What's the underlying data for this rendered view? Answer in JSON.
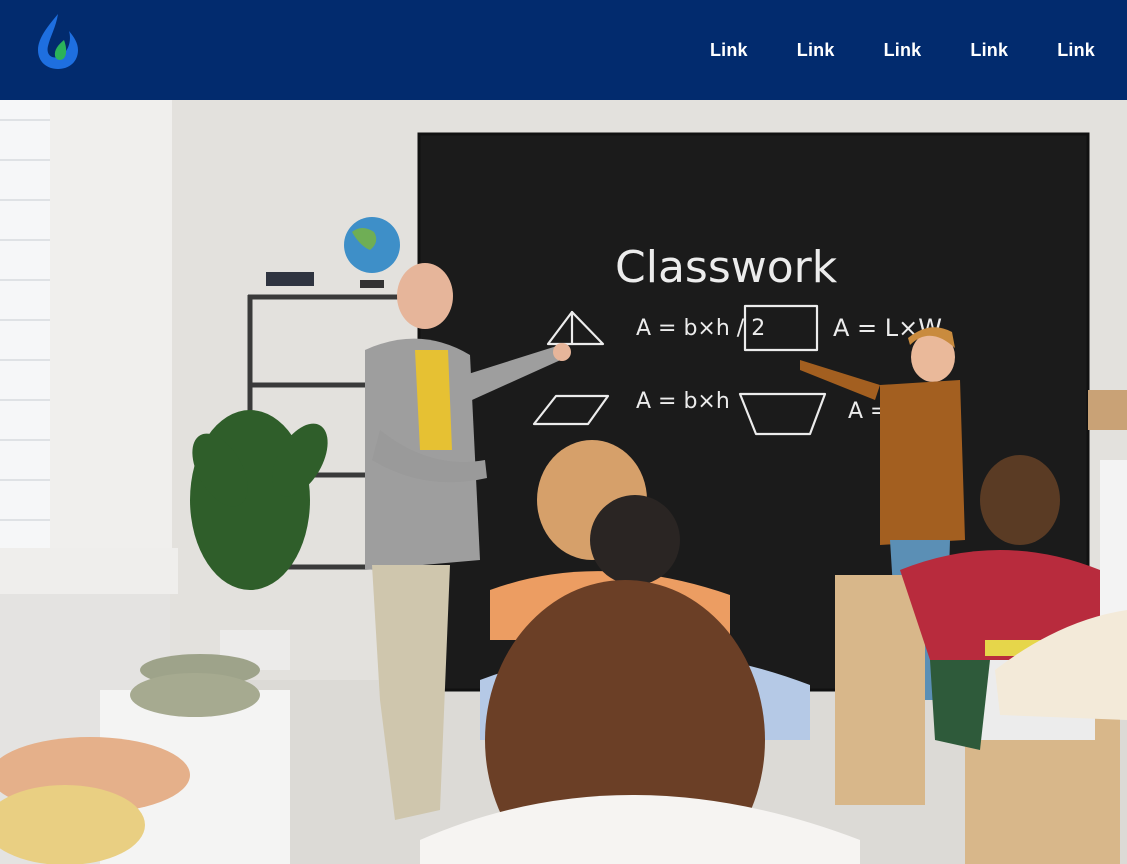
{
  "header": {
    "logo_icon": "water-drop-leaf-icon",
    "nav_links": [
      "Link",
      "Link",
      "Link",
      "Link",
      "Link"
    ]
  },
  "hero": {
    "image_subject": "classroom-photo",
    "chalkboard": {
      "title": "Classwork",
      "formula_triangle": "A = b×h / 2",
      "formula_parallelogram": "A = b×h",
      "formula_rectangle": "A = L×W",
      "formula_trapezoid": "A ="
    }
  },
  "colors": {
    "navbar_bg": "#022b6e",
    "nav_text": "#ffffff",
    "logo_blue": "#1e6fe0",
    "logo_green": "#2bb35a"
  }
}
